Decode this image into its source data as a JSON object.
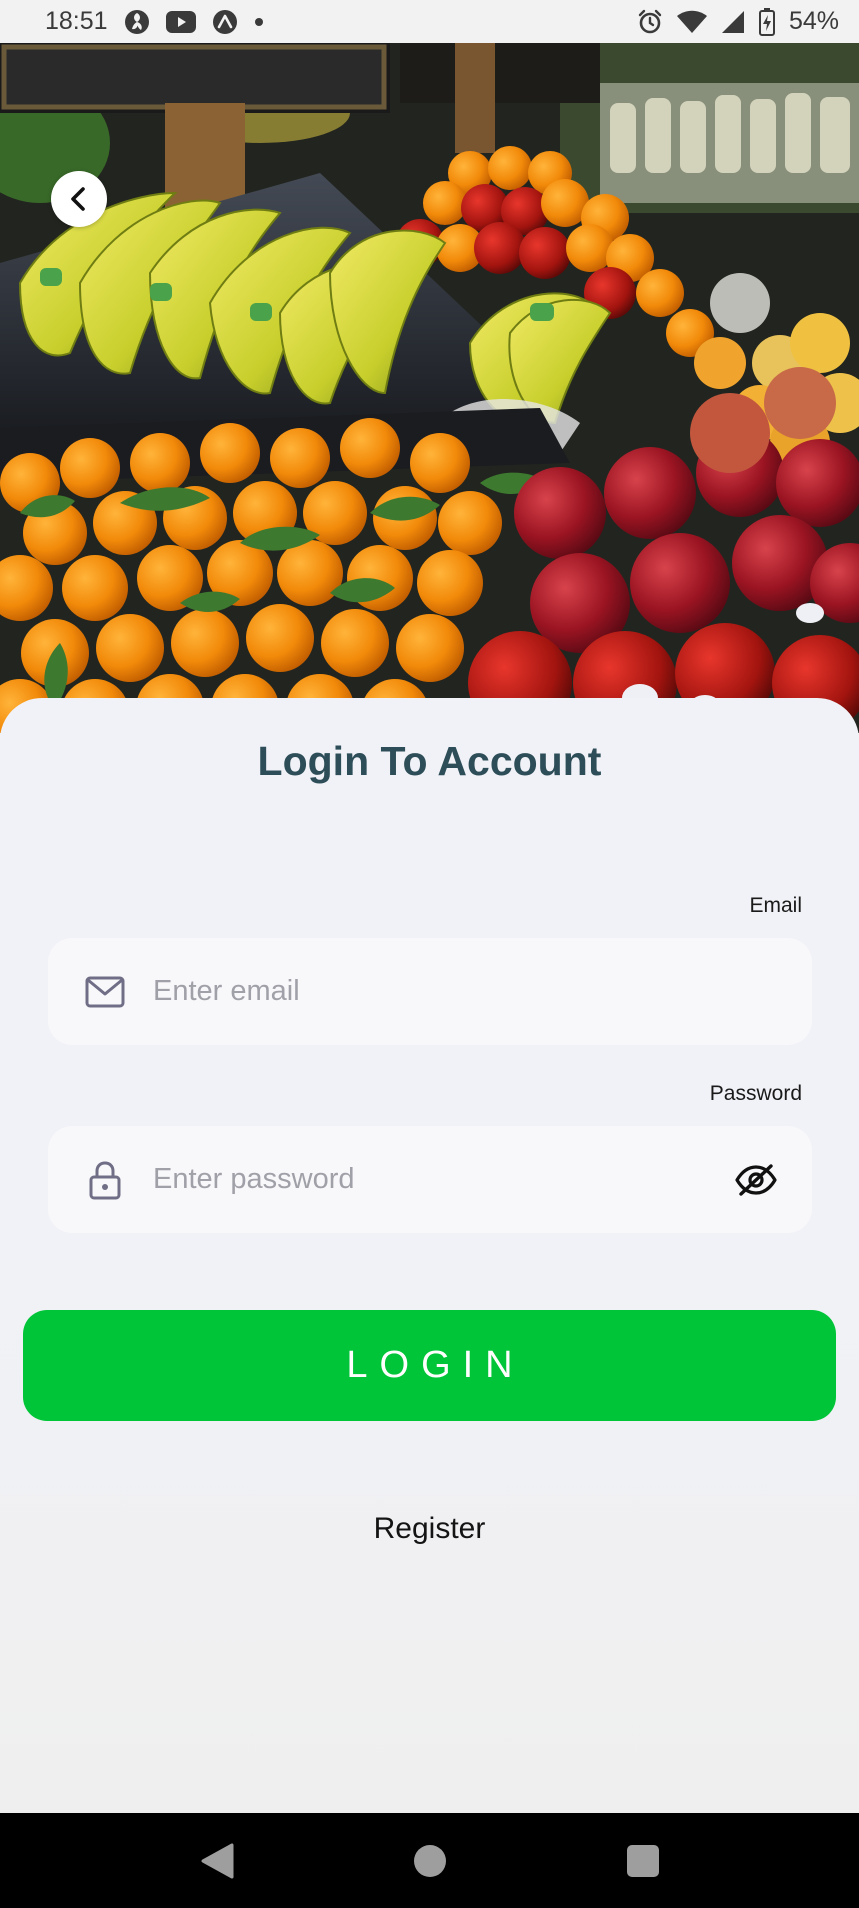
{
  "status_bar": {
    "time": "18:51",
    "battery_percent": "54%",
    "left_icons": [
      "fan-app-icon",
      "youtube-icon",
      "expo-icon",
      "dot-icon"
    ],
    "right_icons": [
      "alarm-icon",
      "wifi-icon",
      "signal-icon",
      "battery-charging-icon"
    ]
  },
  "hero": {
    "image": "fruit-market-photo",
    "back_icon": "chevron-left-icon"
  },
  "login": {
    "title": "Login To Account",
    "email": {
      "label": "Email",
      "placeholder": "Enter email",
      "value": "",
      "icon": "mail-icon"
    },
    "password": {
      "label": "Password",
      "placeholder": "Enter password",
      "value": "",
      "icon": "lock-icon",
      "toggle_icon": "eye-off-icon"
    },
    "login_button": "LOGIN",
    "register_link": "Register"
  },
  "colors": {
    "title": "#2d4e58",
    "button": "#00c538",
    "sheet": "#f1f2f7",
    "input": "#f8f8fa"
  },
  "nav_bar": {
    "buttons": [
      "back-triangle-icon",
      "home-circle-icon",
      "recents-square-icon"
    ]
  }
}
